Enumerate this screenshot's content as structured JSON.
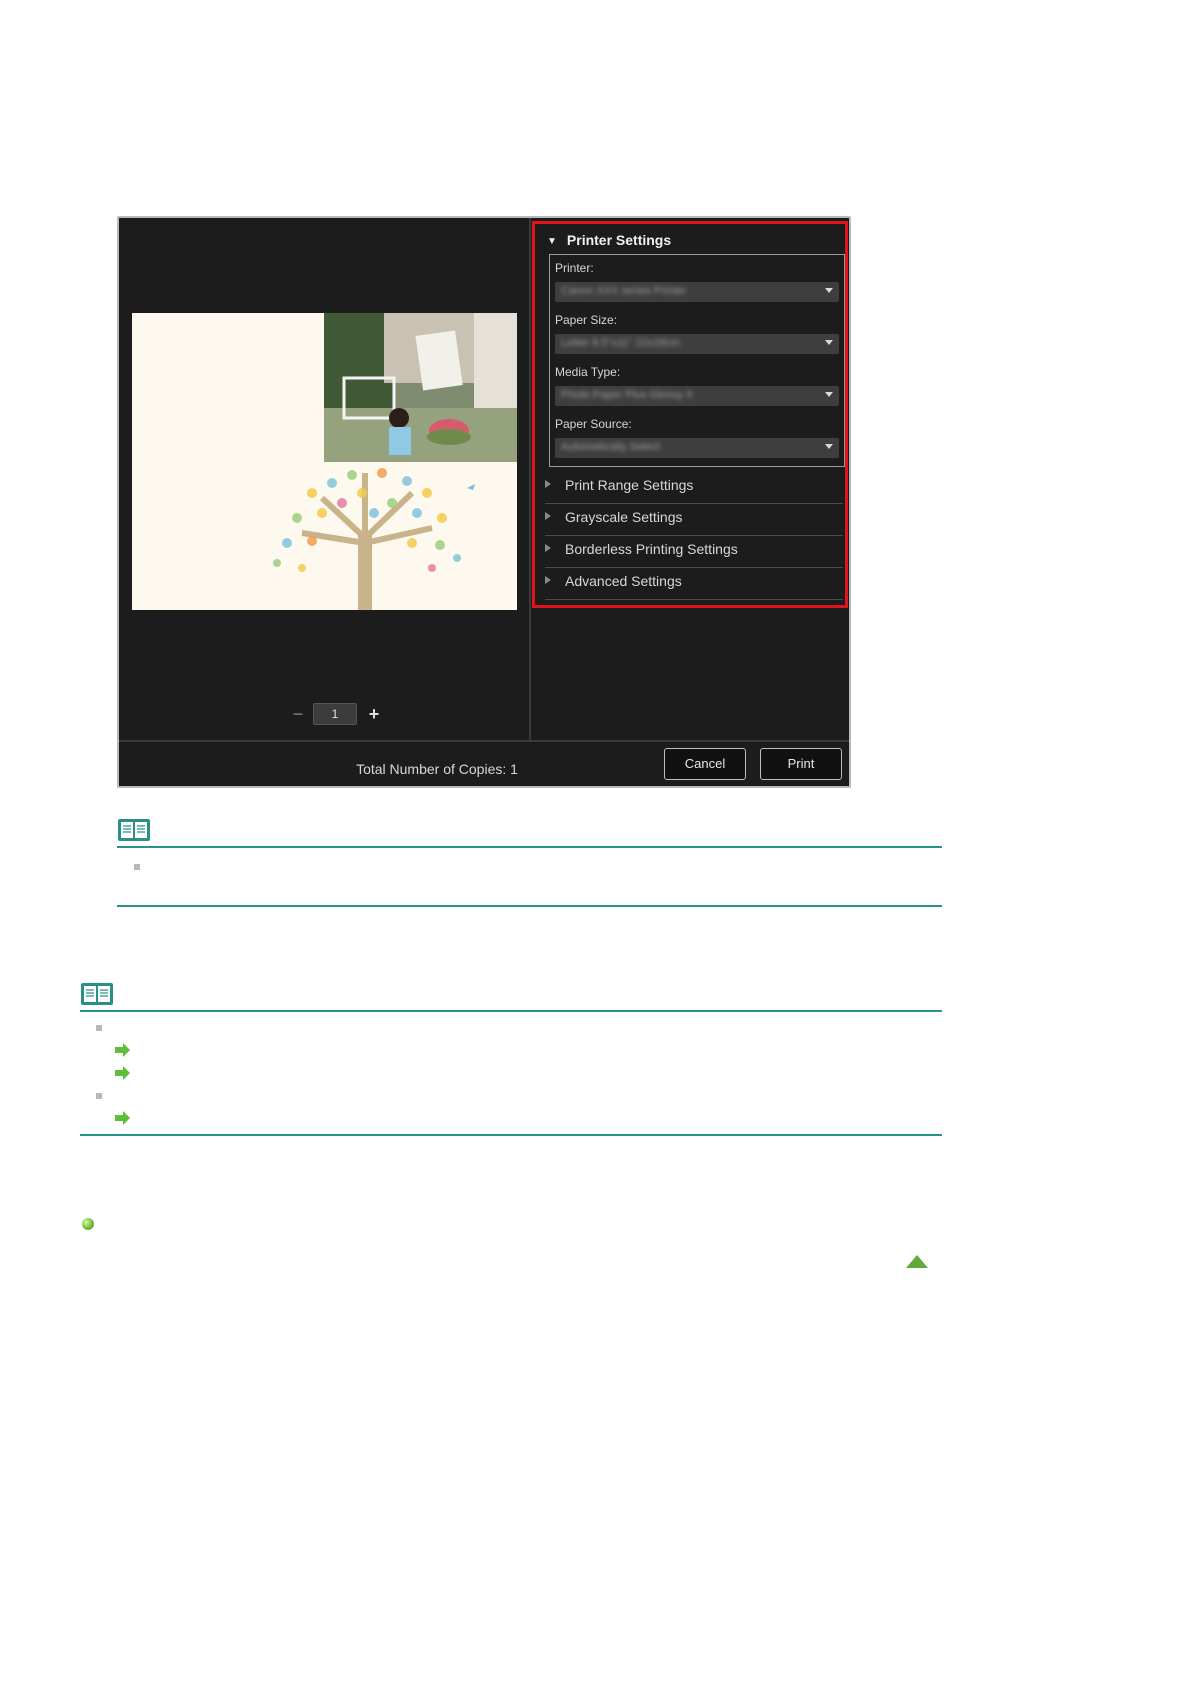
{
  "dialog": {
    "printer_settings": {
      "header": "Printer Settings",
      "fields": [
        {
          "label": "Printer:",
          "value": "Canon XXX series Printer"
        },
        {
          "label": "Paper Size:",
          "value": "Letter 8.5\"x11\" 22x28cm"
        },
        {
          "label": "Media Type:",
          "value": "Photo Paper Plus Glossy II"
        },
        {
          "label": "Paper Source:",
          "value": "Automatically Select"
        }
      ]
    },
    "collapsed_sections": [
      {
        "label": "Print Range Settings"
      },
      {
        "label": "Grayscale Settings"
      },
      {
        "label": "Borderless Printing Settings"
      },
      {
        "label": "Advanced Settings"
      }
    ],
    "copies": {
      "minus": "−",
      "value": "1",
      "plus": "+"
    },
    "total_copies": "Total Number of Copies:  1",
    "buttons": {
      "cancel": "Cancel",
      "print": "Print"
    }
  },
  "colors": {
    "highlight_frame": "#e0141e",
    "dialog_bg": "#1c1c1c",
    "note_rule": "#27938a",
    "link_arrow": "#5fbf3a"
  }
}
